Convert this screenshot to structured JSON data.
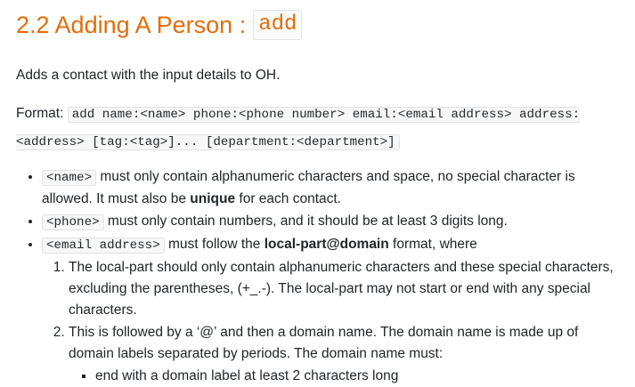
{
  "heading": {
    "text": "2.2 Adding A Person : ",
    "command": "add"
  },
  "intro": "Adds a contact with the input details to OH.",
  "format": {
    "label": "Format: ",
    "code": "add name:<name> phone:<phone number> email:<email address> address:<address> [tag:<tag>]... [department:<department>]"
  },
  "bullets": [
    {
      "code": "<name>",
      "text_before": " must only contain alphanumeric characters and space, no special character is allowed. It must also be ",
      "bold": "unique",
      "text_after": " for each contact."
    },
    {
      "code": "<phone>",
      "text": " must only contain numbers, and it should be at least 3 digits long."
    },
    {
      "code": "<email address>",
      "text_before": " must follow the ",
      "bold": "local-part@domain",
      "text_after": " format, where",
      "subitems": [
        "The local-part should only contain alphanumeric characters and these special characters, excluding the parentheses, (+_.-). The local-part may not start or end with any special characters.",
        "This is followed by a ‘@’ and then a domain name. The domain name is made up of domain labels separated by periods. The domain name must:"
      ],
      "subsub": [
        "end with a domain label at least 2 characters long"
      ]
    }
  ]
}
